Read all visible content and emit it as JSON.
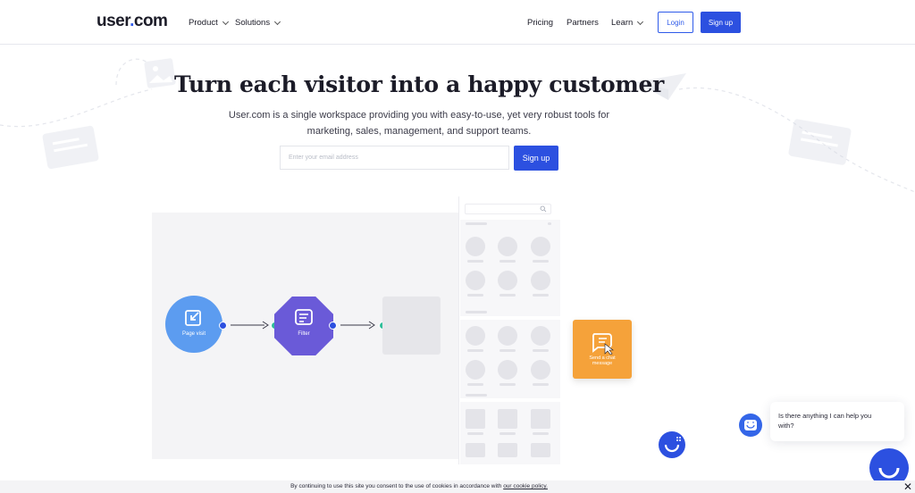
{
  "header": {
    "logo_text": "user",
    "logo_dot": ".",
    "logo_suffix": "com",
    "nav_left": [
      {
        "label": "Product"
      },
      {
        "label": "Solutions"
      }
    ],
    "nav_right": [
      {
        "label": "Pricing"
      },
      {
        "label": "Partners"
      },
      {
        "label": "Learn"
      }
    ],
    "login_label": "Login",
    "signup_label": "Sign up"
  },
  "hero": {
    "title": "Turn each visitor into a happy customer",
    "subtitle_line1": "User.com is a single workspace providing you with easy-to-use, yet very robust tools for",
    "subtitle_line2": "marketing, sales, management, and support teams.",
    "email_placeholder": "Enter your email address",
    "signup_label": "Sign up"
  },
  "flow": {
    "node1_label": "Page visit",
    "node2_label": "Filter",
    "card_label_line1": "Send a chat",
    "card_label_line2": "message"
  },
  "chat": {
    "line1": "Is there anything I can help you",
    "line2": "with?"
  },
  "cookie": {
    "text": "By continuing to use this site you consent to the use of cookies in accordance with ",
    "link": "our cookie policy.",
    "close": "✕"
  },
  "colors": {
    "brand_blue": "#2c50e0",
    "node_blue": "#5c9cf0",
    "node_purple": "#6a5ad8",
    "orange": "#f5a23a",
    "port_green": "#2fbf9a"
  }
}
